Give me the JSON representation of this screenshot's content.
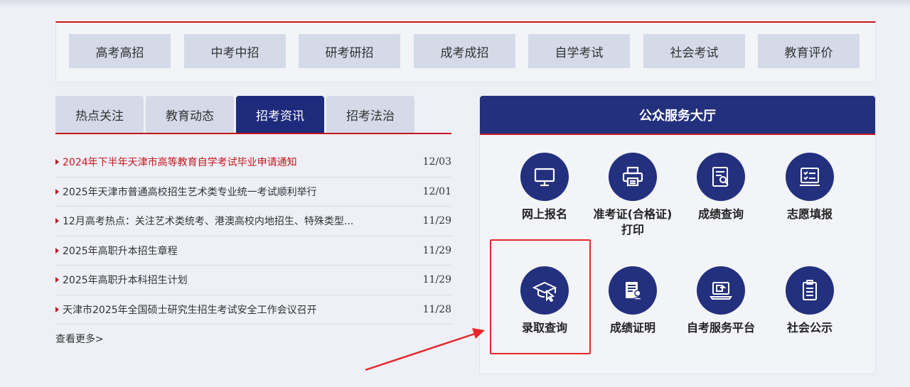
{
  "categories": [
    "高考高招",
    "中考中招",
    "研考研招",
    "成考成招",
    "自学考试",
    "社会考试",
    "教育评价"
  ],
  "tabs": [
    {
      "label": "热点关注",
      "active": false
    },
    {
      "label": "教育动态",
      "active": false
    },
    {
      "label": "招考资讯",
      "active": true
    },
    {
      "label": "招考法治",
      "active": false
    }
  ],
  "news": [
    {
      "title": "2024年下半年天津市高等教育自学考试毕业申请通知",
      "date": "12/03",
      "hot": true
    },
    {
      "title": "2025年天津市普通高校招生艺术类专业统一考试顺利举行",
      "date": "12/01",
      "hot": false
    },
    {
      "title": "12月高考热点：关注艺术类统考、港澳高校内地招生、特殊类型...",
      "date": "11/29",
      "hot": false
    },
    {
      "title": "2025年高职升本招生章程",
      "date": "11/29",
      "hot": false
    },
    {
      "title": "2025年高职升本科招生计划",
      "date": "11/29",
      "hot": false
    },
    {
      "title": "天津市2025年全国硕士研究生招生考试安全工作会议召开",
      "date": "11/28",
      "hot": false
    }
  ],
  "more_label": "查看更多>",
  "hall": {
    "title": "公众服务大厅",
    "services": [
      {
        "label": "网上报名",
        "icon": "monitor-icon"
      },
      {
        "label": "准考证(合格证)打印",
        "icon": "printer-icon"
      },
      {
        "label": "成绩查询",
        "icon": "score-search-icon"
      },
      {
        "label": "志愿填报",
        "icon": "form-checklist-icon"
      },
      {
        "label": "录取查询",
        "icon": "graduation-cap-icon"
      },
      {
        "label": "成绩证明",
        "icon": "certificate-icon"
      },
      {
        "label": "自考服务平台",
        "icon": "laptop-platform-icon"
      },
      {
        "label": "社会公示",
        "icon": "clipboard-icon"
      }
    ]
  },
  "colors": {
    "accent_red": "#c4161c",
    "navy": "#23307e",
    "tab_bg": "#d4dae8"
  }
}
